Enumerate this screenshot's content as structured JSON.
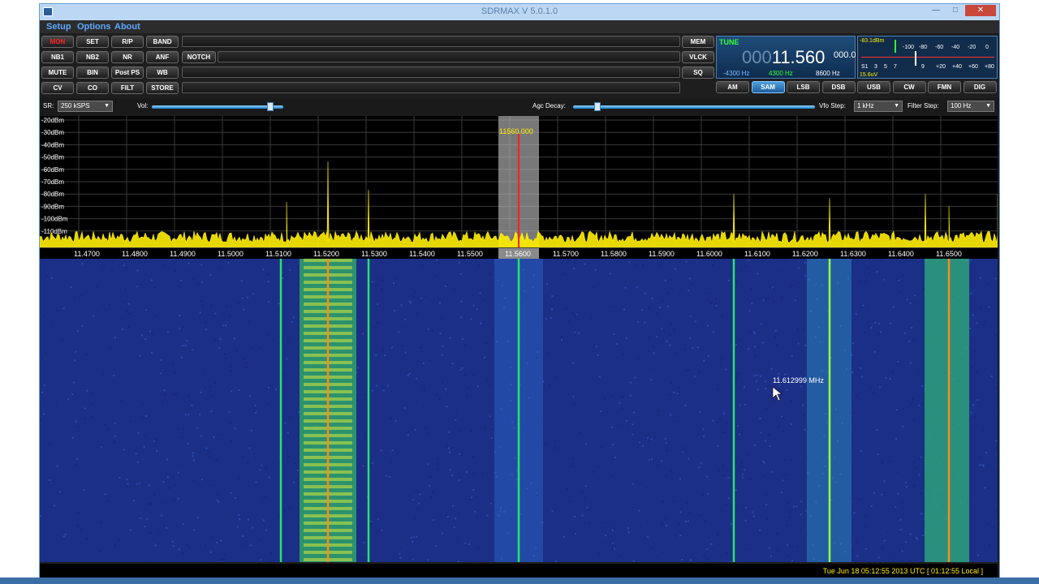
{
  "window": {
    "title": "SDRMAX V 5.0.1.0",
    "controls": [
      "—",
      "□",
      "✕"
    ]
  },
  "menu": [
    "Setup",
    "Options",
    "About"
  ],
  "toolbar": {
    "row1": [
      "MON",
      "SET",
      "R/P",
      "BAND"
    ],
    "row2": [
      "NB1",
      "NB2",
      "NR",
      "ANF",
      "NOTCH"
    ],
    "row3": [
      "MUTE",
      "BIN",
      "Post PS",
      "WB"
    ],
    "row4": [
      "CV",
      "CO",
      "FILT",
      "STORE"
    ],
    "right": [
      "MEM",
      "VLCK",
      "SQ"
    ]
  },
  "tune": {
    "label": "TUNE",
    "freq_dim": "000",
    "freq_main": "11.560",
    "freq_sub": "000.0",
    "offsets": [
      "-4300 Hz",
      "4300 Hz",
      "8600 Hz"
    ]
  },
  "smeter": {
    "level": "-83.1dBm",
    "reading": "15.6uV",
    "scale_top": [
      "-100",
      "-80",
      "-60",
      "-40",
      "-20",
      "0"
    ],
    "scale_bottom": [
      "S1",
      "3",
      "5",
      "7",
      "9",
      "+20",
      "+40",
      "+60",
      "+80"
    ]
  },
  "modes": [
    "AM",
    "SAM",
    "LSB",
    "DSB",
    "USB",
    "CW",
    "FMN",
    "DIG"
  ],
  "active_mode": "SAM",
  "controls": {
    "sr_label": "SR:",
    "sr_value": "250 kSPS",
    "vol_label": "Vol:",
    "vol_level": 0.9,
    "agc_label": "Agc Decay:",
    "agc_level": 0.1,
    "vfo_label": "Vfo Step:",
    "vfo_value": "1 kHz",
    "filter_label": "Filter Step:",
    "filter_value": "100 Hz"
  },
  "spectrum": {
    "db_labels": [
      "-20dBm",
      "-30dBm",
      "-40dBm",
      "-50dBm",
      "-60dBm",
      "-70dBm",
      "-80dBm",
      "-90dBm",
      "-100dBm",
      "-110dBm"
    ],
    "freq_labels": [
      "11.4700",
      "11.4800",
      "11.4900",
      "11.5000",
      "11.5100",
      "11.5200",
      "11.5300",
      "11.5400",
      "11.5500",
      "11.5600",
      "11.5700",
      "11.5800",
      "11.5900",
      "11.6000",
      "11.6100",
      "11.6200",
      "11.6300",
      "11.6400",
      "11.6500"
    ],
    "tuned_label": "11560.000",
    "cursor_label": "11.612999  MHz"
  },
  "status": {
    "clock": "Tue Jun 18 05:12:55 2013 UTC [ 01:12:55 Local ]"
  },
  "colors": {
    "accent": "#1e5f9e",
    "freq_text": "#ffee00",
    "waterfall_bg": "#1c2f86",
    "spectrum_fill": "#ffee00",
    "marker": "#ff2020"
  }
}
